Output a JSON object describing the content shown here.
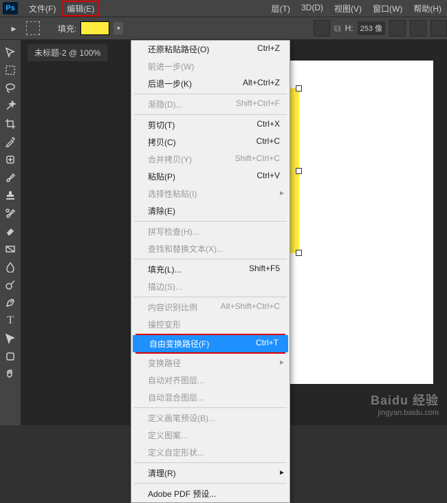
{
  "menubar": {
    "items": [
      "文件(F)",
      "编辑(E)",
      "层(T)",
      "3D(D)",
      "视图(V)",
      "窗口(W)",
      "帮助(H)"
    ]
  },
  "optbar": {
    "fill_label": "填充:",
    "h_label": "H:",
    "h_value": "253 像"
  },
  "tab_title": "未标题-2 @ 100%",
  "dropdown": {
    "groups": [
      [
        {
          "l": "还原粘贴路径(O)",
          "s": "Ctrl+Z",
          "d": false
        },
        {
          "l": "前进一步(W)",
          "s": "",
          "d": true
        },
        {
          "l": "后退一步(K)",
          "s": "Alt+Ctrl+Z",
          "d": false
        }
      ],
      [
        {
          "l": "渐隐(D)...",
          "s": "Shift+Ctrl+F",
          "d": true
        }
      ],
      [
        {
          "l": "剪切(T)",
          "s": "Ctrl+X",
          "d": false
        },
        {
          "l": "拷贝(C)",
          "s": "Ctrl+C",
          "d": false
        },
        {
          "l": "合并拷贝(Y)",
          "s": "Shift+Ctrl+C",
          "d": true
        },
        {
          "l": "粘贴(P)",
          "s": "Ctrl+V",
          "d": false
        },
        {
          "l": "选择性粘贴(I)",
          "s": "",
          "d": true,
          "sub": true
        },
        {
          "l": "清除(E)",
          "s": "",
          "d": false
        }
      ],
      [
        {
          "l": "拼写检查(H)...",
          "s": "",
          "d": true
        },
        {
          "l": "查找和替换文本(X)...",
          "s": "",
          "d": true
        }
      ],
      [
        {
          "l": "填充(L)...",
          "s": "Shift+F5",
          "d": false
        },
        {
          "l": "描边(S)...",
          "s": "",
          "d": true
        }
      ],
      [
        {
          "l": "内容识别比例",
          "s": "Alt+Shift+Ctrl+C",
          "d": true
        },
        {
          "l": "操控变形",
          "s": "",
          "d": true
        },
        {
          "l": "自由变换路径(F)",
          "s": "Ctrl+T",
          "d": false,
          "sel": true
        },
        {
          "l": "变换路径",
          "s": "",
          "d": true,
          "sub": true
        },
        {
          "l": "自动对齐图层...",
          "s": "",
          "d": true
        },
        {
          "l": "自动混合图层...",
          "s": "",
          "d": true
        }
      ],
      [
        {
          "l": "定义画笔预设(B)...",
          "s": "",
          "d": true
        },
        {
          "l": "定义图案...",
          "s": "",
          "d": true
        },
        {
          "l": "定义自定形状...",
          "s": "",
          "d": true
        }
      ],
      [
        {
          "l": "清理(R)",
          "s": "",
          "d": false,
          "sub": true
        }
      ],
      [
        {
          "l": "Adobe PDF 预设...",
          "s": "",
          "d": false
        }
      ]
    ]
  },
  "watermark": {
    "logo": "Baidu 经验",
    "url": "jingyan.baidu.com"
  }
}
